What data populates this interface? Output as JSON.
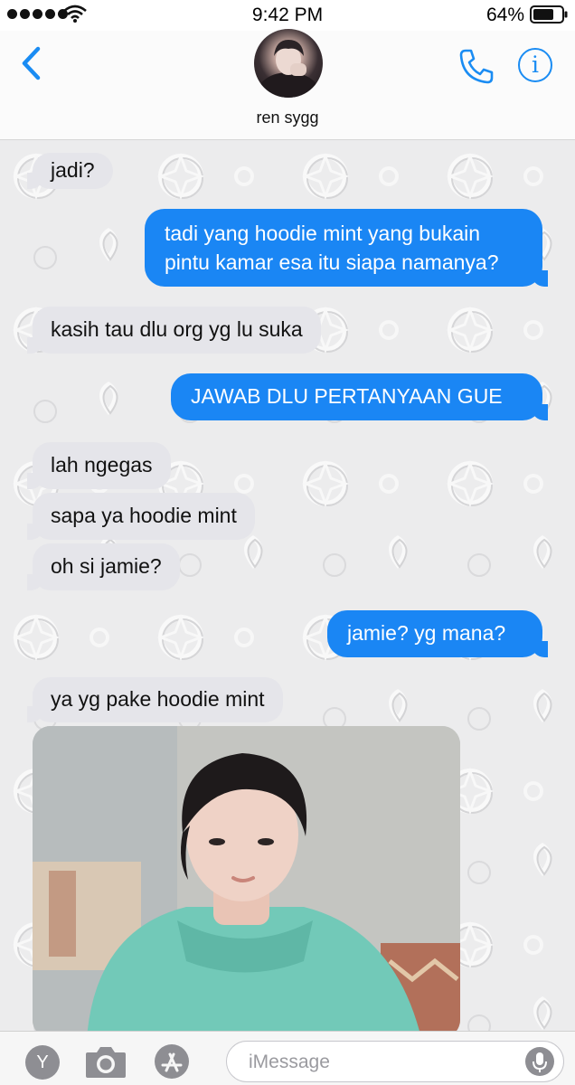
{
  "status_bar": {
    "time": "9:42 PM",
    "battery": "64%",
    "signal_icon": "signal-dots-icon",
    "wifi_icon": "wifi-icon",
    "battery_icon": "battery-icon"
  },
  "header": {
    "contact_name": "ren sygg",
    "back_icon": "chevron-left-icon",
    "call_icon": "phone-icon",
    "info_glyph": "i",
    "accent_color": "#1a8cf3"
  },
  "messages": [
    {
      "direction": "incoming",
      "text": "jadi?"
    },
    {
      "direction": "outgoing",
      "lines": [
        "tadi yang hoodie mint yang bukain",
        "pintu kamar esa itu siapa namanya?"
      ]
    },
    {
      "direction": "incoming",
      "text": "kasih tau dlu org yg lu suka"
    },
    {
      "direction": "outgoing",
      "text": "JAWAB DLU PERTANYAAN GUE"
    },
    {
      "direction": "incoming",
      "text": "lah ngegas"
    },
    {
      "direction": "incoming",
      "text": "sapa ya hoodie mint"
    },
    {
      "direction": "incoming",
      "text": "oh si jamie?"
    },
    {
      "direction": "outgoing",
      "text": "jamie? yg mana?"
    },
    {
      "direction": "incoming",
      "text": "ya yg pake hoodie mint"
    },
    {
      "direction": "incoming",
      "type": "photo"
    }
  ],
  "colors": {
    "outgoing_bubble": "#1a86f4",
    "incoming_bubble": "#e5e5ea"
  },
  "input_bar": {
    "apps_glyph": "Y",
    "camera_icon": "camera-icon",
    "appstore_icon": "app-store-icon",
    "placeholder": "iMessage",
    "mic_icon": "microphone-icon"
  }
}
